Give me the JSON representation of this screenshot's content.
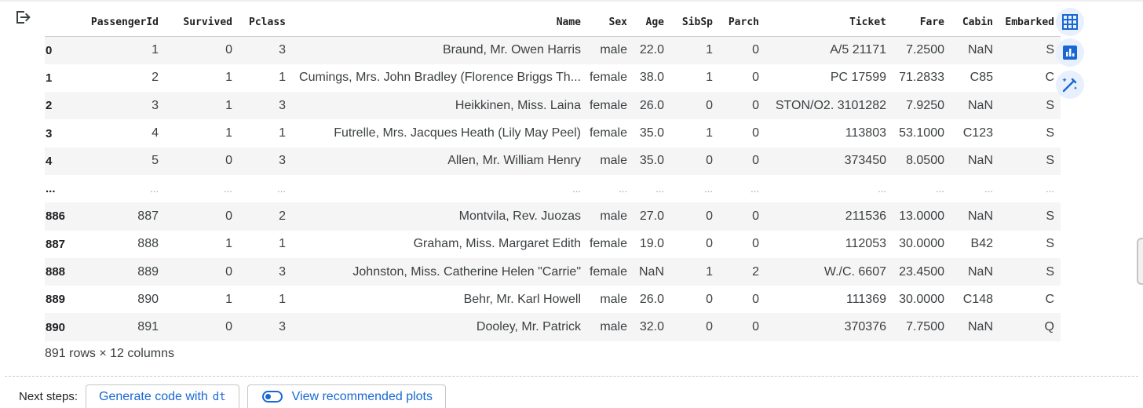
{
  "table": {
    "columns": [
      "",
      "PassengerId",
      "Survived",
      "Pclass",
      "Name",
      "Sex",
      "Age",
      "SibSp",
      "Parch",
      "Ticket",
      "Fare",
      "Cabin",
      "Embarked"
    ],
    "rows": [
      [
        "0",
        "1",
        "0",
        "3",
        "Braund, Mr. Owen Harris",
        "male",
        "22.0",
        "1",
        "0",
        "A/5 21171",
        "7.2500",
        "NaN",
        "S"
      ],
      [
        "1",
        "2",
        "1",
        "1",
        "Cumings, Mrs. John Bradley (Florence Briggs Th...",
        "female",
        "38.0",
        "1",
        "0",
        "PC 17599",
        "71.2833",
        "C85",
        "C"
      ],
      [
        "2",
        "3",
        "1",
        "3",
        "Heikkinen, Miss. Laina",
        "female",
        "26.0",
        "0",
        "0",
        "STON/O2. 3101282",
        "7.9250",
        "NaN",
        "S"
      ],
      [
        "3",
        "4",
        "1",
        "1",
        "Futrelle, Mrs. Jacques Heath (Lily May Peel)",
        "female",
        "35.0",
        "1",
        "0",
        "113803",
        "53.1000",
        "C123",
        "S"
      ],
      [
        "4",
        "5",
        "0",
        "3",
        "Allen, Mr. William Henry",
        "male",
        "35.0",
        "0",
        "0",
        "373450",
        "8.0500",
        "NaN",
        "S"
      ],
      [
        "...",
        "...",
        "...",
        "...",
        "...",
        "...",
        "...",
        "...",
        "...",
        "...",
        "...",
        "...",
        "..."
      ],
      [
        "886",
        "887",
        "0",
        "2",
        "Montvila, Rev. Juozas",
        "male",
        "27.0",
        "0",
        "0",
        "211536",
        "13.0000",
        "NaN",
        "S"
      ],
      [
        "887",
        "888",
        "1",
        "1",
        "Graham, Miss. Margaret Edith",
        "female",
        "19.0",
        "0",
        "0",
        "112053",
        "30.0000",
        "B42",
        "S"
      ],
      [
        "888",
        "889",
        "0",
        "3",
        "Johnston, Miss. Catherine Helen \"Carrie\"",
        "female",
        "NaN",
        "1",
        "2",
        "W./C. 6607",
        "23.4500",
        "NaN",
        "S"
      ],
      [
        "889",
        "890",
        "1",
        "1",
        "Behr, Mr. Karl Howell",
        "male",
        "26.0",
        "0",
        "0",
        "111369",
        "30.0000",
        "C148",
        "C"
      ],
      [
        "890",
        "891",
        "0",
        "3",
        "Dooley, Mr. Patrick",
        "male",
        "32.0",
        "0",
        "0",
        "370376",
        "7.7500",
        "NaN",
        "Q"
      ]
    ]
  },
  "shape_text": "891 rows × 12 columns",
  "next_steps": {
    "label": "Next steps:",
    "generate_label": "Generate code with",
    "generate_var": "dt",
    "plots_label": "View recommended plots"
  },
  "icons": {
    "output": "output-exit-icon",
    "table_view": "table-icon",
    "chart": "bar-chart-icon",
    "magic": "magic-wand-icon"
  },
  "colors": {
    "accent": "#1967d2",
    "button_bg": "#e8f0fe",
    "stripe": "#f5f5f5"
  }
}
